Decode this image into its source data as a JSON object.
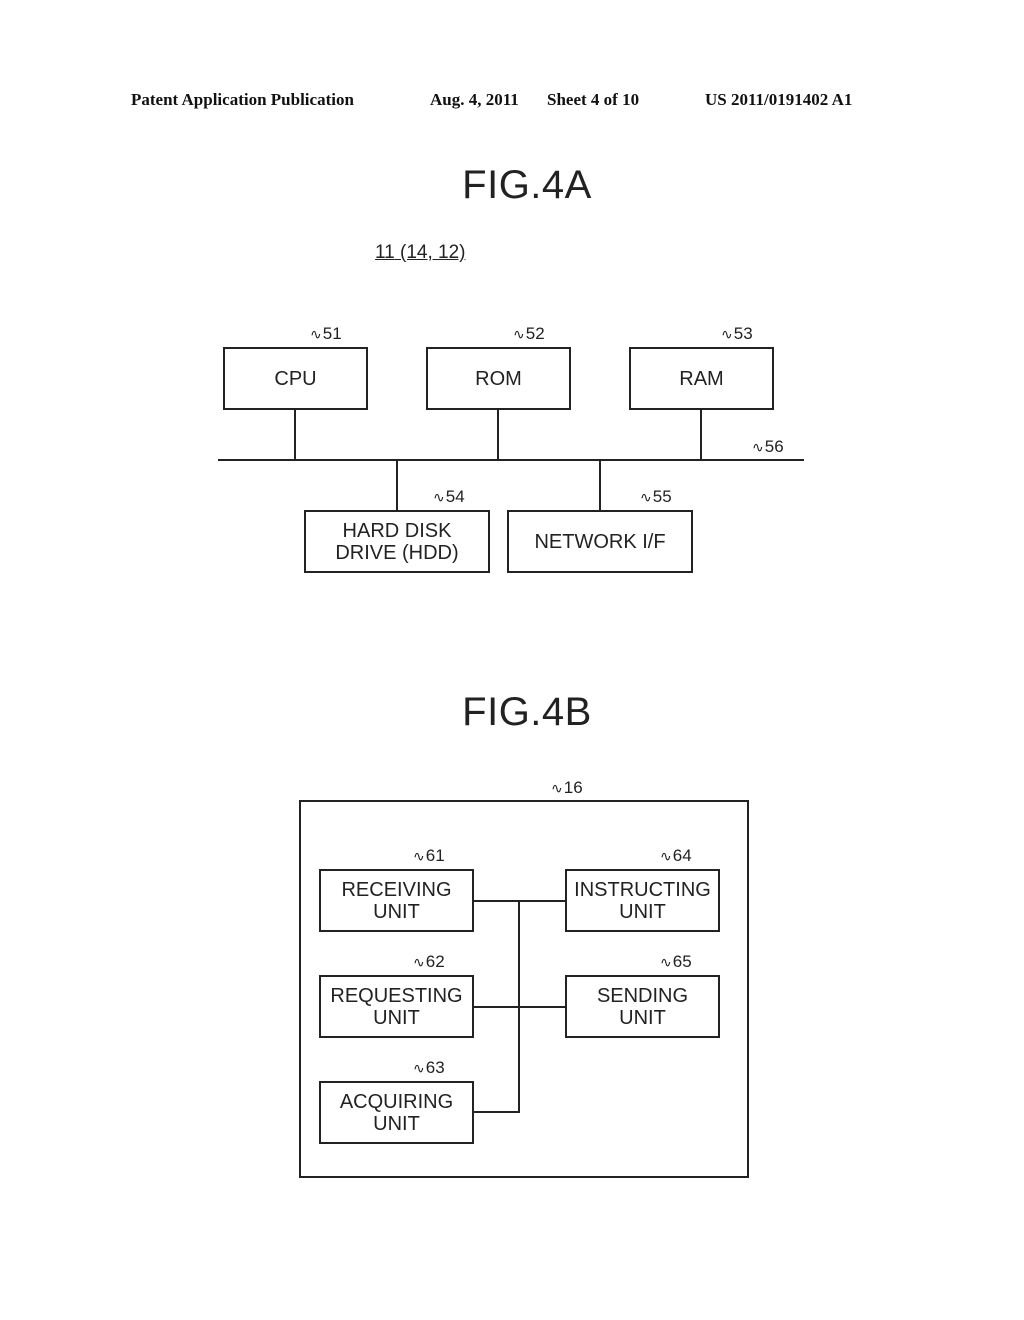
{
  "header": {
    "left": "Patent Application Publication",
    "date": "Aug. 4, 2011",
    "sheet": "Sheet 4 of 10",
    "number": "US 2011/0191402 A1"
  },
  "fig4a": {
    "title": "FIG.4A",
    "device_ref": "11",
    "device_alt_refs": "(14, 12)",
    "bus_ref": "56",
    "blocks": [
      {
        "ref": "51",
        "label": "CPU"
      },
      {
        "ref": "52",
        "label": "ROM"
      },
      {
        "ref": "53",
        "label": "RAM"
      },
      {
        "ref": "54",
        "label_line1": "HARD DISK",
        "label_line2": "DRIVE (HDD)"
      },
      {
        "ref": "55",
        "label": "NETWORK I/F"
      }
    ]
  },
  "fig4b": {
    "title": "FIG.4B",
    "container_ref": "16",
    "units": [
      {
        "ref": "61",
        "line1": "RECEIVING",
        "line2": "UNIT"
      },
      {
        "ref": "62",
        "line1": "REQUESTING",
        "line2": "UNIT"
      },
      {
        "ref": "63",
        "line1": "ACQUIRING",
        "line2": "UNIT"
      },
      {
        "ref": "64",
        "line1": "INSTRUCTING",
        "line2": "UNIT"
      },
      {
        "ref": "65",
        "line1": "SENDING",
        "line2": "UNIT"
      }
    ]
  },
  "squiggle": "∿"
}
